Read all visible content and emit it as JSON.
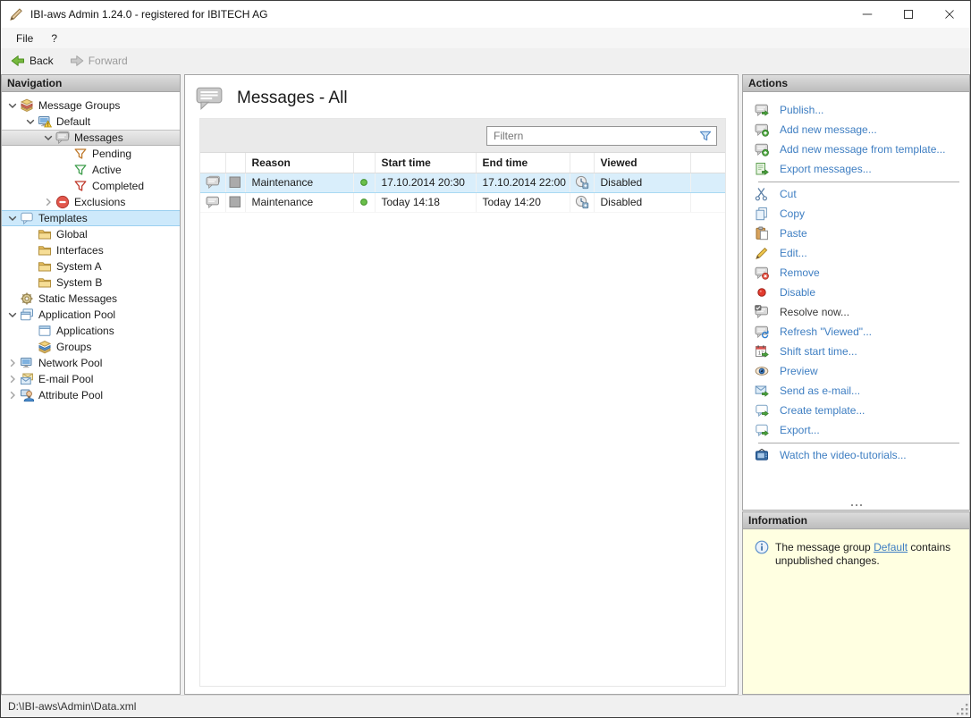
{
  "window": {
    "title": "IBI-aws Admin 1.24.0 - registered for IBITECH AG"
  },
  "menubar": {
    "items": [
      {
        "label": "File"
      },
      {
        "label": "?"
      }
    ]
  },
  "toolbar": {
    "back_label": "Back",
    "forward_label": "Forward"
  },
  "navigation": {
    "header": "Navigation",
    "items": [
      {
        "label": "Message Groups",
        "icon": "message-groups-icon",
        "level": 0,
        "chevron": "expanded"
      },
      {
        "label": "Default",
        "icon": "default-group-icon",
        "level": 1,
        "chevron": "expanded"
      },
      {
        "label": "Messages",
        "icon": "messages-icon",
        "level": 2,
        "chevron": "expanded",
        "selected": "gray"
      },
      {
        "label": "Pending",
        "icon": "funnel-orange-icon",
        "level": 3
      },
      {
        "label": "Active",
        "icon": "funnel-green-icon",
        "level": 3
      },
      {
        "label": "Completed",
        "icon": "funnel-red-icon",
        "level": 3
      },
      {
        "label": "Exclusions",
        "icon": "exclusions-icon",
        "level": 2,
        "chevron": "collapsed"
      },
      {
        "label": "Templates",
        "icon": "templates-icon",
        "level": 0,
        "chevron": "expanded",
        "selected": "blue"
      },
      {
        "label": "Global",
        "icon": "folder-icon",
        "level": 1
      },
      {
        "label": "Interfaces",
        "icon": "folder-icon",
        "level": 1
      },
      {
        "label": "System A",
        "icon": "folder-icon",
        "level": 1
      },
      {
        "label": "System B",
        "icon": "folder-icon",
        "level": 1
      },
      {
        "label": "Static Messages",
        "icon": "static-messages-icon",
        "level": 0
      },
      {
        "label": "Application Pool",
        "icon": "application-pool-icon",
        "level": 0,
        "chevron": "expanded"
      },
      {
        "label": "Applications",
        "icon": "applications-icon",
        "level": 1
      },
      {
        "label": "Groups",
        "icon": "groups-icon",
        "level": 1
      },
      {
        "label": "Network Pool",
        "icon": "network-pool-icon",
        "level": 0,
        "chevron": "collapsed"
      },
      {
        "label": "E-mail Pool",
        "icon": "email-pool-icon",
        "level": 0,
        "chevron": "collapsed"
      },
      {
        "label": "Attribute Pool",
        "icon": "attribute-pool-icon",
        "level": 0,
        "chevron": "collapsed"
      }
    ]
  },
  "main": {
    "title": "Messages - All",
    "filter_placeholder": "Filtern",
    "table": {
      "columns": [
        {
          "key": "type_icon",
          "label": ""
        },
        {
          "key": "color",
          "label": ""
        },
        {
          "key": "reason",
          "label": "Reason"
        },
        {
          "key": "status",
          "label": ""
        },
        {
          "key": "start",
          "label": "Start time"
        },
        {
          "key": "end",
          "label": "End time"
        },
        {
          "key": "viewed_icon",
          "label": ""
        },
        {
          "key": "viewed",
          "label": "Viewed"
        }
      ],
      "rows": [
        {
          "type_icon": "message-double-bubble-icon",
          "color": "gray-square-icon",
          "reason": "Maintenance",
          "status": "green-dot-icon",
          "start": "17.10.2014 20:30",
          "end": "17.10.2014 22:00",
          "viewed_icon": "clock-icon",
          "viewed": "Disabled",
          "selected": true
        },
        {
          "type_icon": "message-bubble-icon",
          "color": "gray-square-icon",
          "reason": "Maintenance",
          "status": "green-dot-icon",
          "start": "Today 14:18",
          "end": "Today 14:20",
          "viewed_icon": "clock-icon",
          "viewed": "Disabled",
          "selected": false
        }
      ]
    }
  },
  "actions": {
    "header": "Actions",
    "groups": [
      [
        {
          "label": "Publish...",
          "icon": "publish-icon",
          "enabled": true
        },
        {
          "label": "Add new message...",
          "icon": "add-message-icon",
          "enabled": true
        },
        {
          "label": "Add new message from template...",
          "icon": "add-message-template-icon",
          "enabled": true
        },
        {
          "label": "Export messages...",
          "icon": "export-messages-icon",
          "enabled": true
        }
      ],
      [
        {
          "label": "Cut",
          "icon": "cut-icon",
          "enabled": true
        },
        {
          "label": "Copy",
          "icon": "copy-icon",
          "enabled": true
        },
        {
          "label": "Paste",
          "icon": "paste-icon",
          "enabled": true
        },
        {
          "label": "Edit...",
          "icon": "edit-icon",
          "enabled": true
        },
        {
          "label": "Remove",
          "icon": "remove-icon",
          "enabled": true
        },
        {
          "label": "Disable",
          "icon": "disable-icon",
          "enabled": true
        },
        {
          "label": "Resolve now...",
          "icon": "resolve-icon",
          "enabled": false
        },
        {
          "label": "Refresh \"Viewed\"...",
          "icon": "refresh-viewed-icon",
          "enabled": true
        },
        {
          "label": "Shift start time...",
          "icon": "shift-time-icon",
          "enabled": true
        },
        {
          "label": "Preview",
          "icon": "preview-icon",
          "enabled": true
        },
        {
          "label": "Send as e-mail...",
          "icon": "send-email-icon",
          "enabled": true
        },
        {
          "label": "Create template...",
          "icon": "create-template-icon",
          "enabled": true
        },
        {
          "label": "Export...",
          "icon": "export-icon",
          "enabled": true
        }
      ],
      [
        {
          "label": "Watch the video-tutorials...",
          "icon": "video-icon",
          "enabled": true
        }
      ]
    ]
  },
  "information": {
    "header": "Information",
    "text_prefix": "The message group ",
    "link": "Default",
    "text_suffix": " contains unpublished changes."
  },
  "statusbar": {
    "path": "D:\\IBI-aws\\Admin\\Data.xml"
  },
  "colors": {
    "link": "#3e7ec2",
    "selection_blue": "#d9eefb",
    "info_bg": "#ffffe1",
    "accent_green": "#76b93e"
  }
}
